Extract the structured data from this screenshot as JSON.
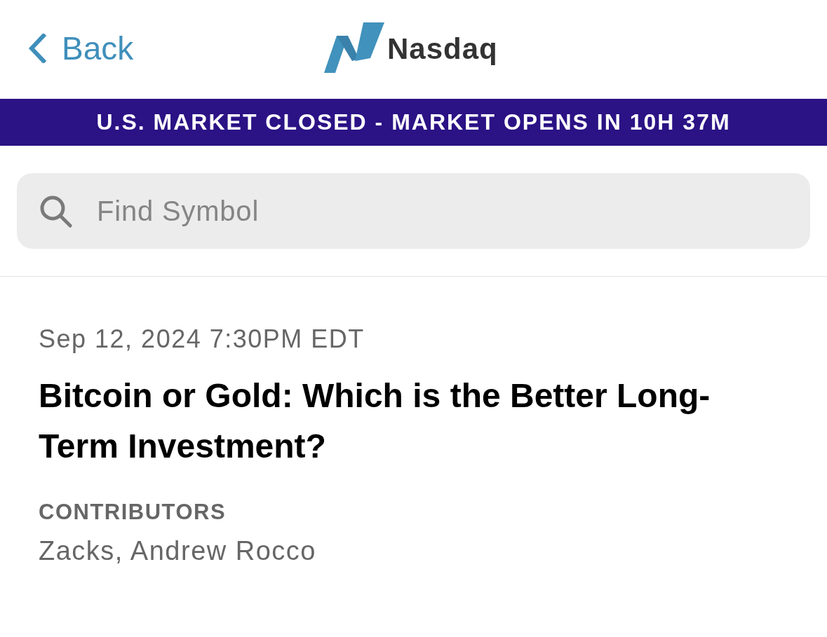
{
  "header": {
    "back_label": "Back",
    "logo_text": "Nasdaq"
  },
  "market_banner": {
    "text": "U.S. MARKET CLOSED - MARKET OPENS IN 10H 37M"
  },
  "search": {
    "placeholder": "Find Symbol"
  },
  "article": {
    "timestamp": "Sep 12, 2024 7:30PM EDT",
    "headline": "Bitcoin or Gold: Which is the Better Long-Term Investment?",
    "contributors_label": "CONTRIBUTORS",
    "contributors": "Zacks, Andrew Rocco"
  }
}
